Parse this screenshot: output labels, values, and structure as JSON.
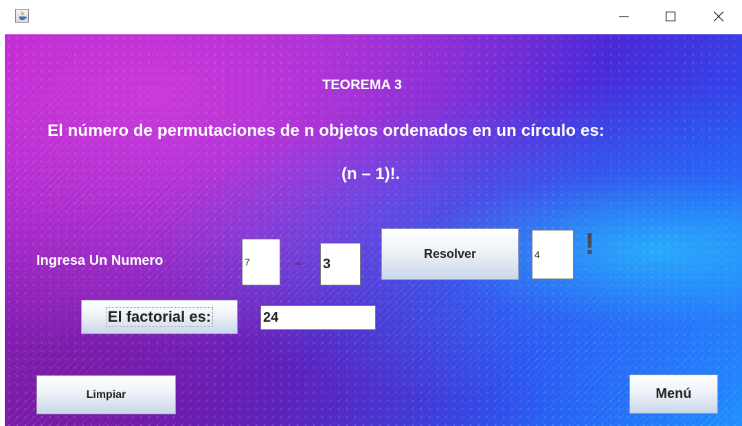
{
  "window": {
    "app_icon": "java-coffee-cup-icon",
    "controls": {
      "minimize_icon": "minimize-icon",
      "maximize_icon": "maximize-icon",
      "close_icon": "close-icon"
    }
  },
  "theorem": {
    "title": "TEOREMA 3",
    "statement": "El número de permutaciones de n objetos ordenados en un círculo es:",
    "formula": "(n – 1)!."
  },
  "form": {
    "prompt_label": "Ingresa Un Numero",
    "n_value": "7",
    "separator": "-",
    "r_value": "3",
    "solve_button": "Resolver",
    "result_value": "4",
    "factorial_mark": "!",
    "factorial_label": "El factorial es:",
    "factorial_value": "24"
  },
  "actions": {
    "clear_button": "Limpiar",
    "menu_button": "Menú"
  },
  "colors": {
    "background_start": "#b31cc9",
    "background_end": "#1e8fff",
    "text": "#ffffff",
    "button_gradient_bottom": "#c9d7ea"
  }
}
